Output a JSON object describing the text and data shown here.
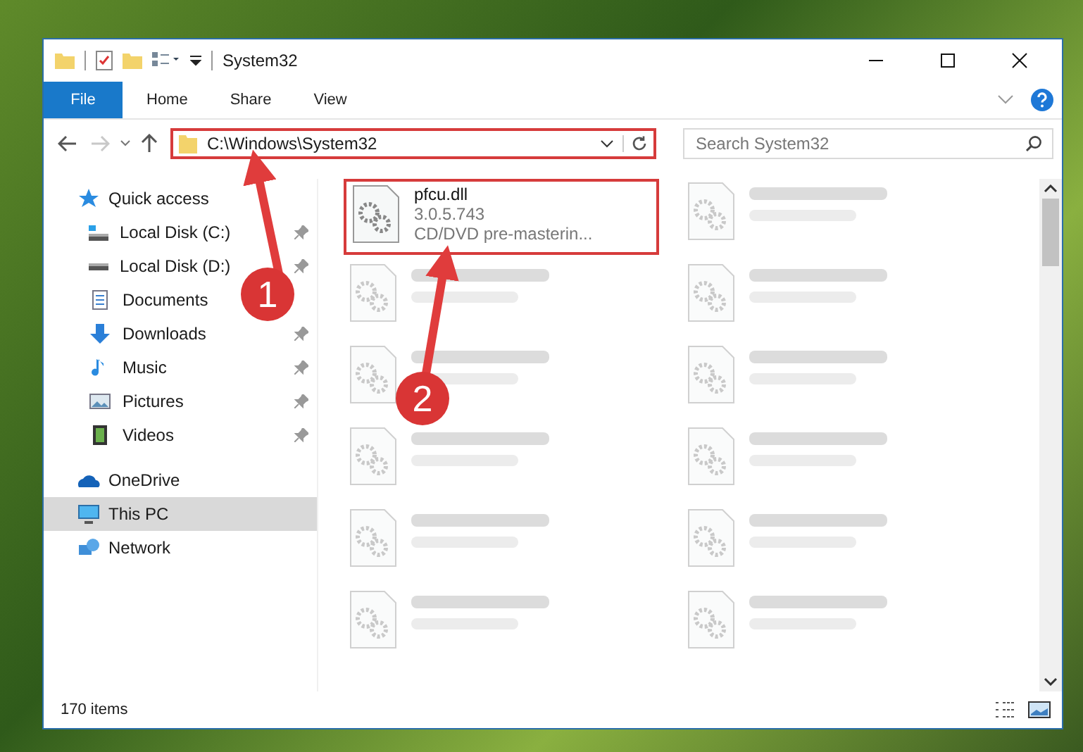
{
  "window": {
    "title": "System32"
  },
  "ribbon": {
    "tabs": [
      {
        "label": "File",
        "selected": true
      },
      {
        "label": "Home",
        "selected": false
      },
      {
        "label": "Share",
        "selected": false
      },
      {
        "label": "View",
        "selected": false
      }
    ]
  },
  "navigation": {
    "back_disabled": false,
    "forward_disabled": true
  },
  "address": {
    "path": "C:\\Windows\\System32",
    "highlighted": true
  },
  "search": {
    "placeholder": "Search System32"
  },
  "sidebar": {
    "items": [
      {
        "label": "Quick access",
        "selected": false,
        "children": [
          {
            "label": "Local Disk (C:)",
            "pinned": true,
            "selected": false
          },
          {
            "label": "Local Disk (D:)",
            "pinned": true,
            "selected": false
          },
          {
            "label": "Documents",
            "pinned": false,
            "selected": false
          },
          {
            "label": "Downloads",
            "pinned": true,
            "selected": false
          },
          {
            "label": "Music",
            "pinned": true,
            "selected": false
          },
          {
            "label": "Pictures",
            "pinned": true,
            "selected": false
          },
          {
            "label": "Videos",
            "pinned": true,
            "selected": false
          }
        ]
      },
      {
        "label": "OneDrive",
        "selected": false
      },
      {
        "label": "This PC",
        "selected": true
      },
      {
        "label": "Network",
        "selected": false
      }
    ]
  },
  "files": [
    {
      "name": "pfcu.dll",
      "details": [
        "3.0.5.743",
        "CD/DVD pre-masterin..."
      ],
      "highlighted": true,
      "blurred": false
    },
    {
      "highlighted": false,
      "blurred": true
    },
    {
      "highlighted": false,
      "blurred": true
    },
    {
      "highlighted": false,
      "blurred": true
    },
    {
      "highlighted": false,
      "blurred": true
    },
    {
      "highlighted": false,
      "blurred": true
    },
    {
      "highlighted": false,
      "blurred": true
    },
    {
      "highlighted": false,
      "blurred": true
    },
    {
      "highlighted": false,
      "blurred": true
    },
    {
      "highlighted": false,
      "blurred": true
    },
    {
      "highlighted": false,
      "blurred": true
    },
    {
      "highlighted": false,
      "blurred": true
    }
  ],
  "status_bar": {
    "item_count": "170 items"
  },
  "annotations": [
    {
      "label": "1"
    },
    {
      "label": "2"
    }
  ]
}
